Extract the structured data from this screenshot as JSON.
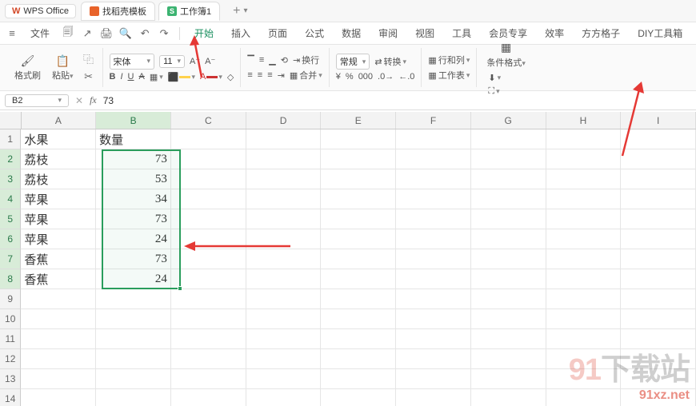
{
  "titlebar": {
    "app_name": "WPS Office",
    "tabs": [
      {
        "label": "找稻壳模板",
        "icon": "orange"
      },
      {
        "label": "工作簿1",
        "icon": "green",
        "icon_text": "S"
      }
    ]
  },
  "menubar": {
    "file": "文件",
    "items": [
      "开始",
      "插入",
      "页面",
      "公式",
      "数据",
      "审阅",
      "视图",
      "工具",
      "会员专享",
      "效率",
      "方方格子",
      "DIY工具箱"
    ],
    "active_index": 0
  },
  "ribbon": {
    "format_painter": "格式刷",
    "paste": "粘贴",
    "font_name": "宋体",
    "font_size": "11",
    "bold": "B",
    "italic": "I",
    "underline": "U",
    "strike": "A",
    "wrap": "换行",
    "merge": "合并",
    "number_format": "常规",
    "transpose": "转换",
    "rows_cols": "行和列",
    "worksheet": "工作表",
    "cond_format": "条件格式",
    "currency": "¥"
  },
  "formulabar": {
    "cell": "B2",
    "value": "73"
  },
  "grid": {
    "columns": [
      "A",
      "B",
      "C",
      "D",
      "E",
      "F",
      "G",
      "H",
      "I"
    ],
    "selected_col": "B",
    "headers": {
      "r1c1": "水果",
      "r1c2": "数量"
    },
    "rows": [
      {
        "a": "荔枝",
        "b": "73"
      },
      {
        "a": "荔枝",
        "b": "53"
      },
      {
        "a": "苹果",
        "b": "34"
      },
      {
        "a": "苹果",
        "b": "73"
      },
      {
        "a": "苹果",
        "b": "24"
      },
      {
        "a": "香蕉",
        "b": "73"
      },
      {
        "a": "香蕉",
        "b": "24"
      }
    ],
    "selected_rows": [
      2,
      3,
      4,
      5,
      6,
      7,
      8
    ],
    "total_visible_rows": 14
  },
  "watermark": {
    "big_plain": "下载站",
    "url": "91xz.net"
  }
}
